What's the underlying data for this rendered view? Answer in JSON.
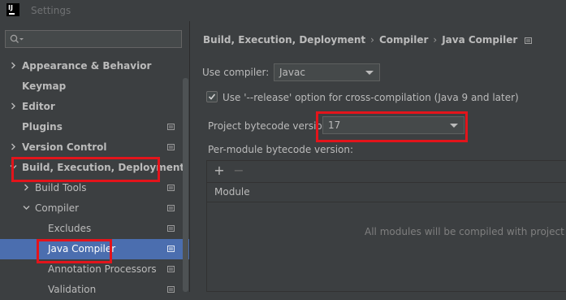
{
  "window": {
    "title": "Settings",
    "logo_text": "IJ"
  },
  "search": {
    "placeholder": ""
  },
  "tree": [
    {
      "label": "Appearance & Behavior",
      "bold": true,
      "expanded": false,
      "has_chevron": true,
      "level": 0,
      "has_icon": false
    },
    {
      "label": "Keymap",
      "bold": true,
      "expanded": false,
      "has_chevron": false,
      "level": 0,
      "has_icon": false
    },
    {
      "label": "Editor",
      "bold": true,
      "expanded": false,
      "has_chevron": true,
      "level": 0,
      "has_icon": false
    },
    {
      "label": "Plugins",
      "bold": true,
      "expanded": false,
      "has_chevron": false,
      "level": 0,
      "has_icon": true
    },
    {
      "label": "Version Control",
      "bold": true,
      "expanded": false,
      "has_chevron": true,
      "level": 0,
      "has_icon": true
    },
    {
      "label": "Build, Execution, Deployment",
      "bold": true,
      "expanded": true,
      "has_chevron": true,
      "level": 0,
      "has_icon": false
    },
    {
      "label": "Build Tools",
      "bold": false,
      "expanded": false,
      "has_chevron": true,
      "level": 1,
      "has_icon": true
    },
    {
      "label": "Compiler",
      "bold": false,
      "expanded": true,
      "has_chevron": true,
      "level": 1,
      "has_icon": true
    },
    {
      "label": "Excludes",
      "bold": false,
      "expanded": false,
      "has_chevron": false,
      "level": 2,
      "has_icon": true
    },
    {
      "label": "Java Compiler",
      "bold": false,
      "expanded": false,
      "has_chevron": false,
      "level": 2,
      "has_icon": true,
      "selected": true
    },
    {
      "label": "Annotation Processors",
      "bold": false,
      "expanded": false,
      "has_chevron": false,
      "level": 2,
      "has_icon": true
    },
    {
      "label": "Validation",
      "bold": false,
      "expanded": false,
      "has_chevron": false,
      "level": 2,
      "has_icon": true
    }
  ],
  "breadcrumb": {
    "items": [
      "Build, Execution, Deployment",
      "Compiler",
      "Java Compiler"
    ],
    "separator": "›"
  },
  "form": {
    "use_compiler_label": "Use compiler:",
    "use_compiler_value": "Javac",
    "release_option_label": "Use '--release' option for cross-compilation (Java 9 and later)",
    "release_option_checked": true,
    "bytecode_label": "Project bytecode version",
    "bytecode_value": "17",
    "per_module_label": "Per-module bytecode version:"
  },
  "modules_table": {
    "add_icon": "plus-icon",
    "remove_icon": "minus-icon",
    "column_header": "Module",
    "empty_text": "All modules will be compiled with project byte"
  },
  "colors": {
    "background": "#3c3f41",
    "selection": "#4b6eaf",
    "highlight_box": "#e3141b",
    "text": "#bbbbbb"
  }
}
